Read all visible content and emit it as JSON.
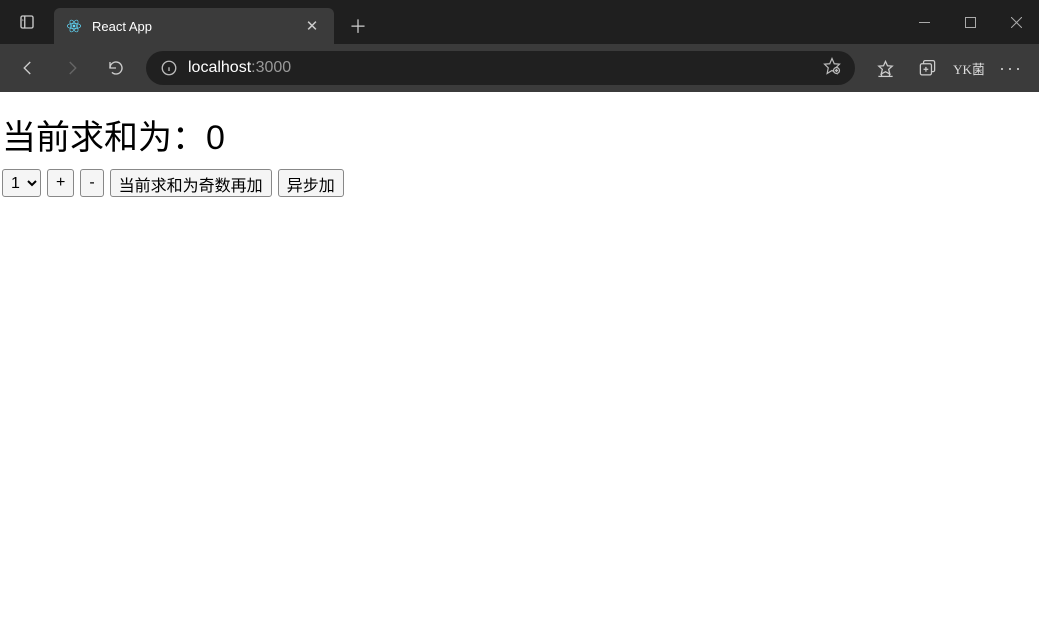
{
  "browser": {
    "tab": {
      "title": "React App"
    },
    "url": {
      "host": "localhost",
      "port": ":3000"
    },
    "profile_label": "YK菌"
  },
  "page": {
    "heading_prefix": "当前求和为：",
    "sum_value": "0",
    "select_value": "1",
    "buttons": {
      "increment": "+",
      "decrement": "-",
      "increment_if_odd": "当前求和为奇数再加",
      "increment_async": "异步加"
    }
  }
}
